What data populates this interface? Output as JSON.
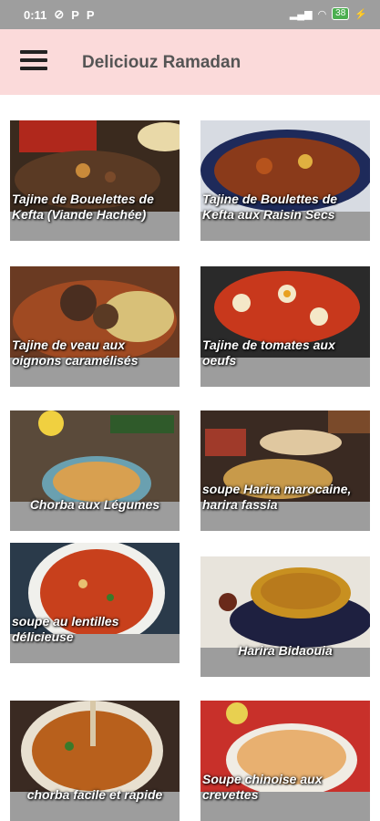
{
  "status": {
    "time": "0:11",
    "icons_left": [
      "clock-icon",
      "p-icon",
      "p-icon"
    ],
    "battery": "38"
  },
  "appbar": {
    "title": "Deliciouz Ramadan",
    "menu_icon": "hamburger-menu-icon"
  },
  "recipes": [
    {
      "name": "Tajine de Bouelettes de Kefta (Viande Hachée)",
      "center": false
    },
    {
      "name": "Tajine de Boulettes de Kefta aux Raisin Secs",
      "center": false
    },
    {
      "name": "Tajine de veau aux oignons caramélisés",
      "center": false
    },
    {
      "name": "Tajine de tomates aux oeufs",
      "center": false
    },
    {
      "name": "Chorba aux Légumes",
      "center": true
    },
    {
      "name": "soupe Harira marocaine, harira fassia",
      "center": false
    },
    {
      "name": "soupe au lentilles délicieuse",
      "center": false
    },
    {
      "name": "Harira Bidaouia",
      "center": true
    },
    {
      "name": "chorba facile et rapide",
      "center": true
    },
    {
      "name": "Soupe chinoise aux crevettes",
      "center": false
    }
  ],
  "colors": {
    "appbar": "#fbdada",
    "statusbar": "#9e9e9e",
    "caption_bar": "#9d9d9d"
  }
}
